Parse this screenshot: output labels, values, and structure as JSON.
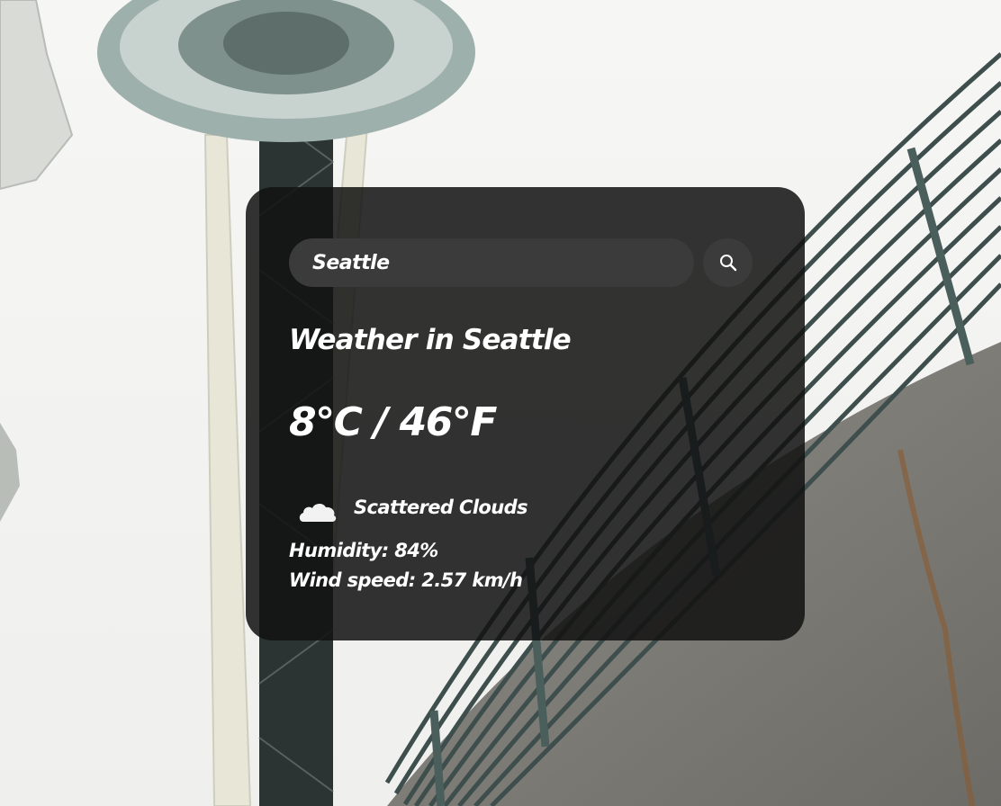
{
  "search": {
    "value": "Seattle",
    "icon": "search-icon"
  },
  "weather": {
    "title": "Weather in Seattle",
    "temperature": "8°C / 46°F",
    "condition_icon": "cloud-icon",
    "condition": "Scattered Clouds",
    "humidity": "Humidity: 84%",
    "wind": "Wind speed: 2.57 km/h"
  },
  "colors": {
    "card_background": "#1e1e1e",
    "input_background": "#3b3b3b",
    "text": "#ffffff"
  }
}
